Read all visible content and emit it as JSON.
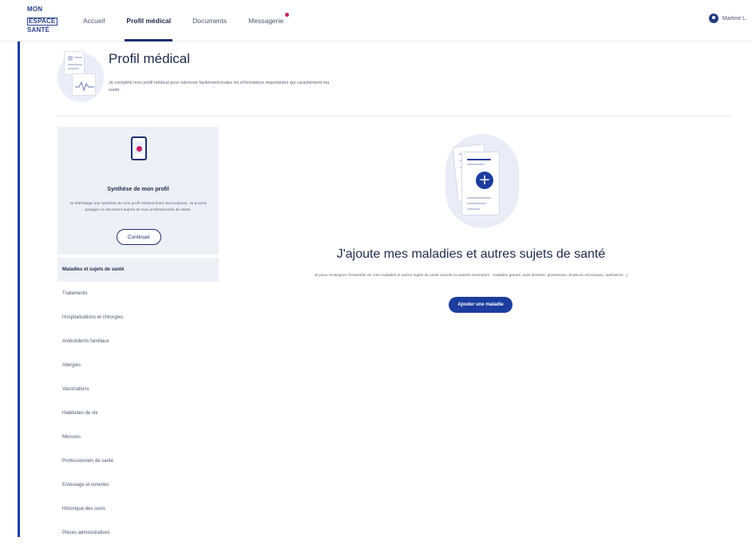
{
  "brand": {
    "logo_line1": "MON",
    "logo_line2": "ESPACE",
    "logo_line3": "SANTÉ"
  },
  "nav": {
    "items": [
      {
        "label": "Accueil",
        "active": false
      },
      {
        "label": "Profil médical",
        "active": true
      },
      {
        "label": "Documents",
        "active": false
      },
      {
        "label": "Messagerie",
        "active": false,
        "notification": true
      }
    ]
  },
  "user": {
    "name": "Martine L."
  },
  "page": {
    "title": "Profil médical",
    "subtitle": "Je complète mon profil médical pour retrouver facilement toutes les informations importantes qui caractérisent ma santé."
  },
  "summary": {
    "title": "Synthèse de mon profil",
    "description": "Je télécharge une synthèse de mon profil médical (hors vaccinations). Je pourrai partager ce document auprès de mes professionnels de santé.",
    "button": "Continuer"
  },
  "menu": {
    "items": [
      {
        "label": "Maladies et sujets de santé",
        "active": true
      },
      {
        "label": "Traitements",
        "active": false
      },
      {
        "label": "Hospitalisations et chirurgies",
        "active": false
      },
      {
        "label": "Antécédents familiaux",
        "active": false
      },
      {
        "label": "Allergies",
        "active": false
      },
      {
        "label": "Vaccinations",
        "active": false
      },
      {
        "label": "Habitudes de vie",
        "active": false
      },
      {
        "label": "Mesures",
        "active": false
      },
      {
        "label": "Professionnels de santé",
        "active": false
      },
      {
        "label": "Entourage et volontés",
        "active": false
      },
      {
        "label": "Historique des soins",
        "active": false
      },
      {
        "label": "Pièces administratives",
        "active": false
      }
    ]
  },
  "main": {
    "title": "J'ajoute mes maladies et autres sujets de santé",
    "description": "Je peux renseigner l'ensemble de mes maladies et autres sujets de santé actuels ou passés (exemples : maladies graves, suivi dentaire, grossesses, douleurs chroniques, opérations...)",
    "button": "Ajouter une maladie"
  },
  "colors": {
    "primary": "#1c3d9e",
    "accent": "#c8206a",
    "panel": "#edf0f7"
  }
}
